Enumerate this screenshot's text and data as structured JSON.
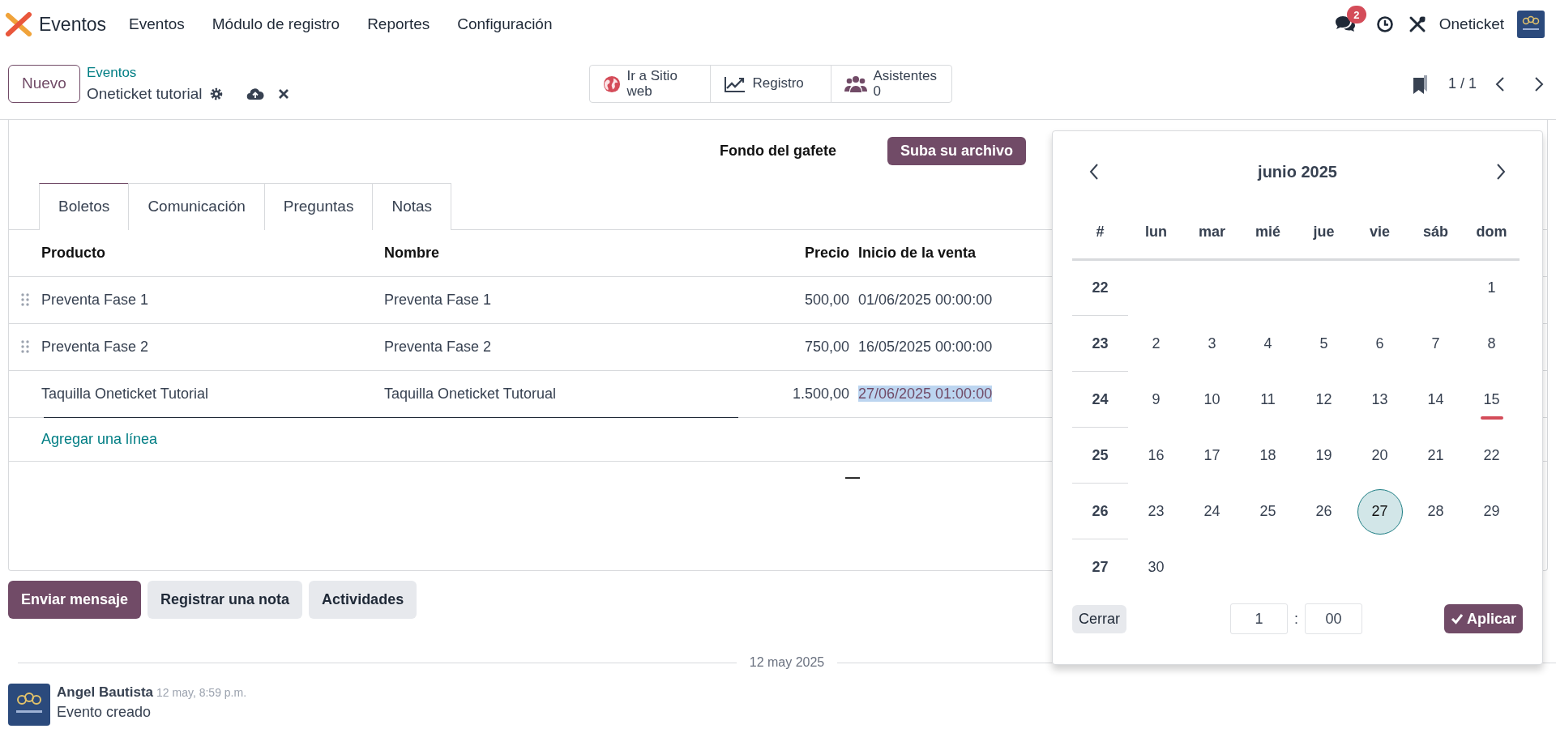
{
  "app": {
    "name": "Eventos",
    "menu": [
      "Eventos",
      "Módulo de registro",
      "Reportes",
      "Configuración"
    ],
    "messages_badge": "2",
    "company": "Oneticket"
  },
  "control_panel": {
    "new_button": "Nuevo",
    "breadcrumb": "Eventos",
    "record_title": "Oneticket tutorial",
    "smart_buttons": [
      {
        "kind": "globe",
        "label": "Ir a Sitio web"
      },
      {
        "kind": "chart",
        "label": "Registro"
      },
      {
        "kind": "people",
        "label": "Asistentes",
        "value": "0"
      }
    ],
    "pager": "1 / 1"
  },
  "form": {
    "field_label": "Fondo del gafete",
    "upload_button": "Suba su archivo",
    "tabs": [
      {
        "label": "Boletos",
        "selected": true
      },
      {
        "label": "Comunicación",
        "selected": false
      },
      {
        "label": "Preguntas",
        "selected": false
      },
      {
        "label": "Notas",
        "selected": false
      }
    ],
    "ticket_table": {
      "columns": [
        "Producto",
        "Nombre",
        "Precio",
        "Inicio de la venta"
      ],
      "rows": [
        {
          "product": "Preventa Fase 1",
          "name": "Preventa Fase 1",
          "price": "500,00",
          "sale_start": "01/06/2025 00:00:00",
          "draggable": true,
          "editing": false
        },
        {
          "product": "Preventa Fase 2",
          "name": "Preventa Fase 2",
          "price": "750,00",
          "sale_start": "16/05/2025 00:00:00",
          "draggable": true,
          "editing": false
        },
        {
          "product": "Taquilla Oneticket Tutorial",
          "name": "Taquilla Oneticket Tutorual",
          "price": "1.500,00",
          "sale_start": "27/06/2025 01:00:00",
          "draggable": false,
          "editing": true
        }
      ],
      "add_line": "Agregar una línea",
      "total": "—"
    }
  },
  "chatter": {
    "buttons": [
      {
        "label": "Enviar mensaje",
        "primary": true
      },
      {
        "label": "Registrar una nota",
        "primary": false
      },
      {
        "label": "Actividades",
        "primary": false
      }
    ],
    "date_separator": "12 may 2025",
    "messages": [
      {
        "author": "Angel Bautista",
        "time": "12 may, 8:59 p.m.",
        "body": "Evento creado"
      }
    ]
  },
  "date_picker": {
    "month": "junio 2025",
    "week_header": "#",
    "weekdays": [
      "lun",
      "mar",
      "mié",
      "jue",
      "vie",
      "sáb",
      "dom"
    ],
    "weeks": [
      {
        "number": "22",
        "kind": "trailing",
        "days": [
          {
            "label": "1",
            "selected": false,
            "today": false
          }
        ]
      },
      {
        "number": "23",
        "days": [
          {
            "label": "2",
            "selected": false,
            "today": false
          },
          {
            "label": "3",
            "selected": false,
            "today": false
          },
          {
            "label": "4",
            "selected": false,
            "today": false
          },
          {
            "label": "5",
            "selected": false,
            "today": false
          },
          {
            "label": "6",
            "selected": false,
            "today": false
          },
          {
            "label": "7",
            "selected": false,
            "today": false
          },
          {
            "label": "8",
            "selected": false,
            "today": false
          }
        ]
      },
      {
        "number": "24",
        "days": [
          {
            "label": "9",
            "selected": false,
            "today": false
          },
          {
            "label": "10",
            "selected": false,
            "today": false
          },
          {
            "label": "11",
            "selected": false,
            "today": false
          },
          {
            "label": "12",
            "selected": false,
            "today": false
          },
          {
            "label": "13",
            "selected": false,
            "today": false
          },
          {
            "label": "14",
            "selected": false,
            "today": false
          },
          {
            "label": "15",
            "selected": false,
            "today": true
          }
        ]
      },
      {
        "number": "25",
        "days": [
          {
            "label": "16",
            "selected": false,
            "today": false
          },
          {
            "label": "17",
            "selected": false,
            "today": false
          },
          {
            "label": "18",
            "selected": false,
            "today": false
          },
          {
            "label": "19",
            "selected": false,
            "today": false
          },
          {
            "label": "20",
            "selected": false,
            "today": false
          },
          {
            "label": "21",
            "selected": false,
            "today": false
          },
          {
            "label": "22",
            "selected": false,
            "today": false
          }
        ]
      },
      {
        "number": "26",
        "days": [
          {
            "label": "23",
            "selected": false,
            "today": false
          },
          {
            "label": "24",
            "selected": false,
            "today": false
          },
          {
            "label": "25",
            "selected": false,
            "today": false
          },
          {
            "label": "26",
            "selected": false,
            "today": false
          },
          {
            "label": "27",
            "selected": true,
            "today": false
          },
          {
            "label": "28",
            "selected": false,
            "today": false
          },
          {
            "label": "29",
            "selected": false,
            "today": false
          }
        ]
      },
      {
        "number": "27",
        "kind": "leading",
        "days": [
          {
            "label": "30",
            "selected": false,
            "today": false
          }
        ]
      }
    ],
    "close_button": "Cerrar",
    "hour": "1",
    "separator": ":",
    "minute": "00",
    "apply_button": "Aplicar"
  }
}
